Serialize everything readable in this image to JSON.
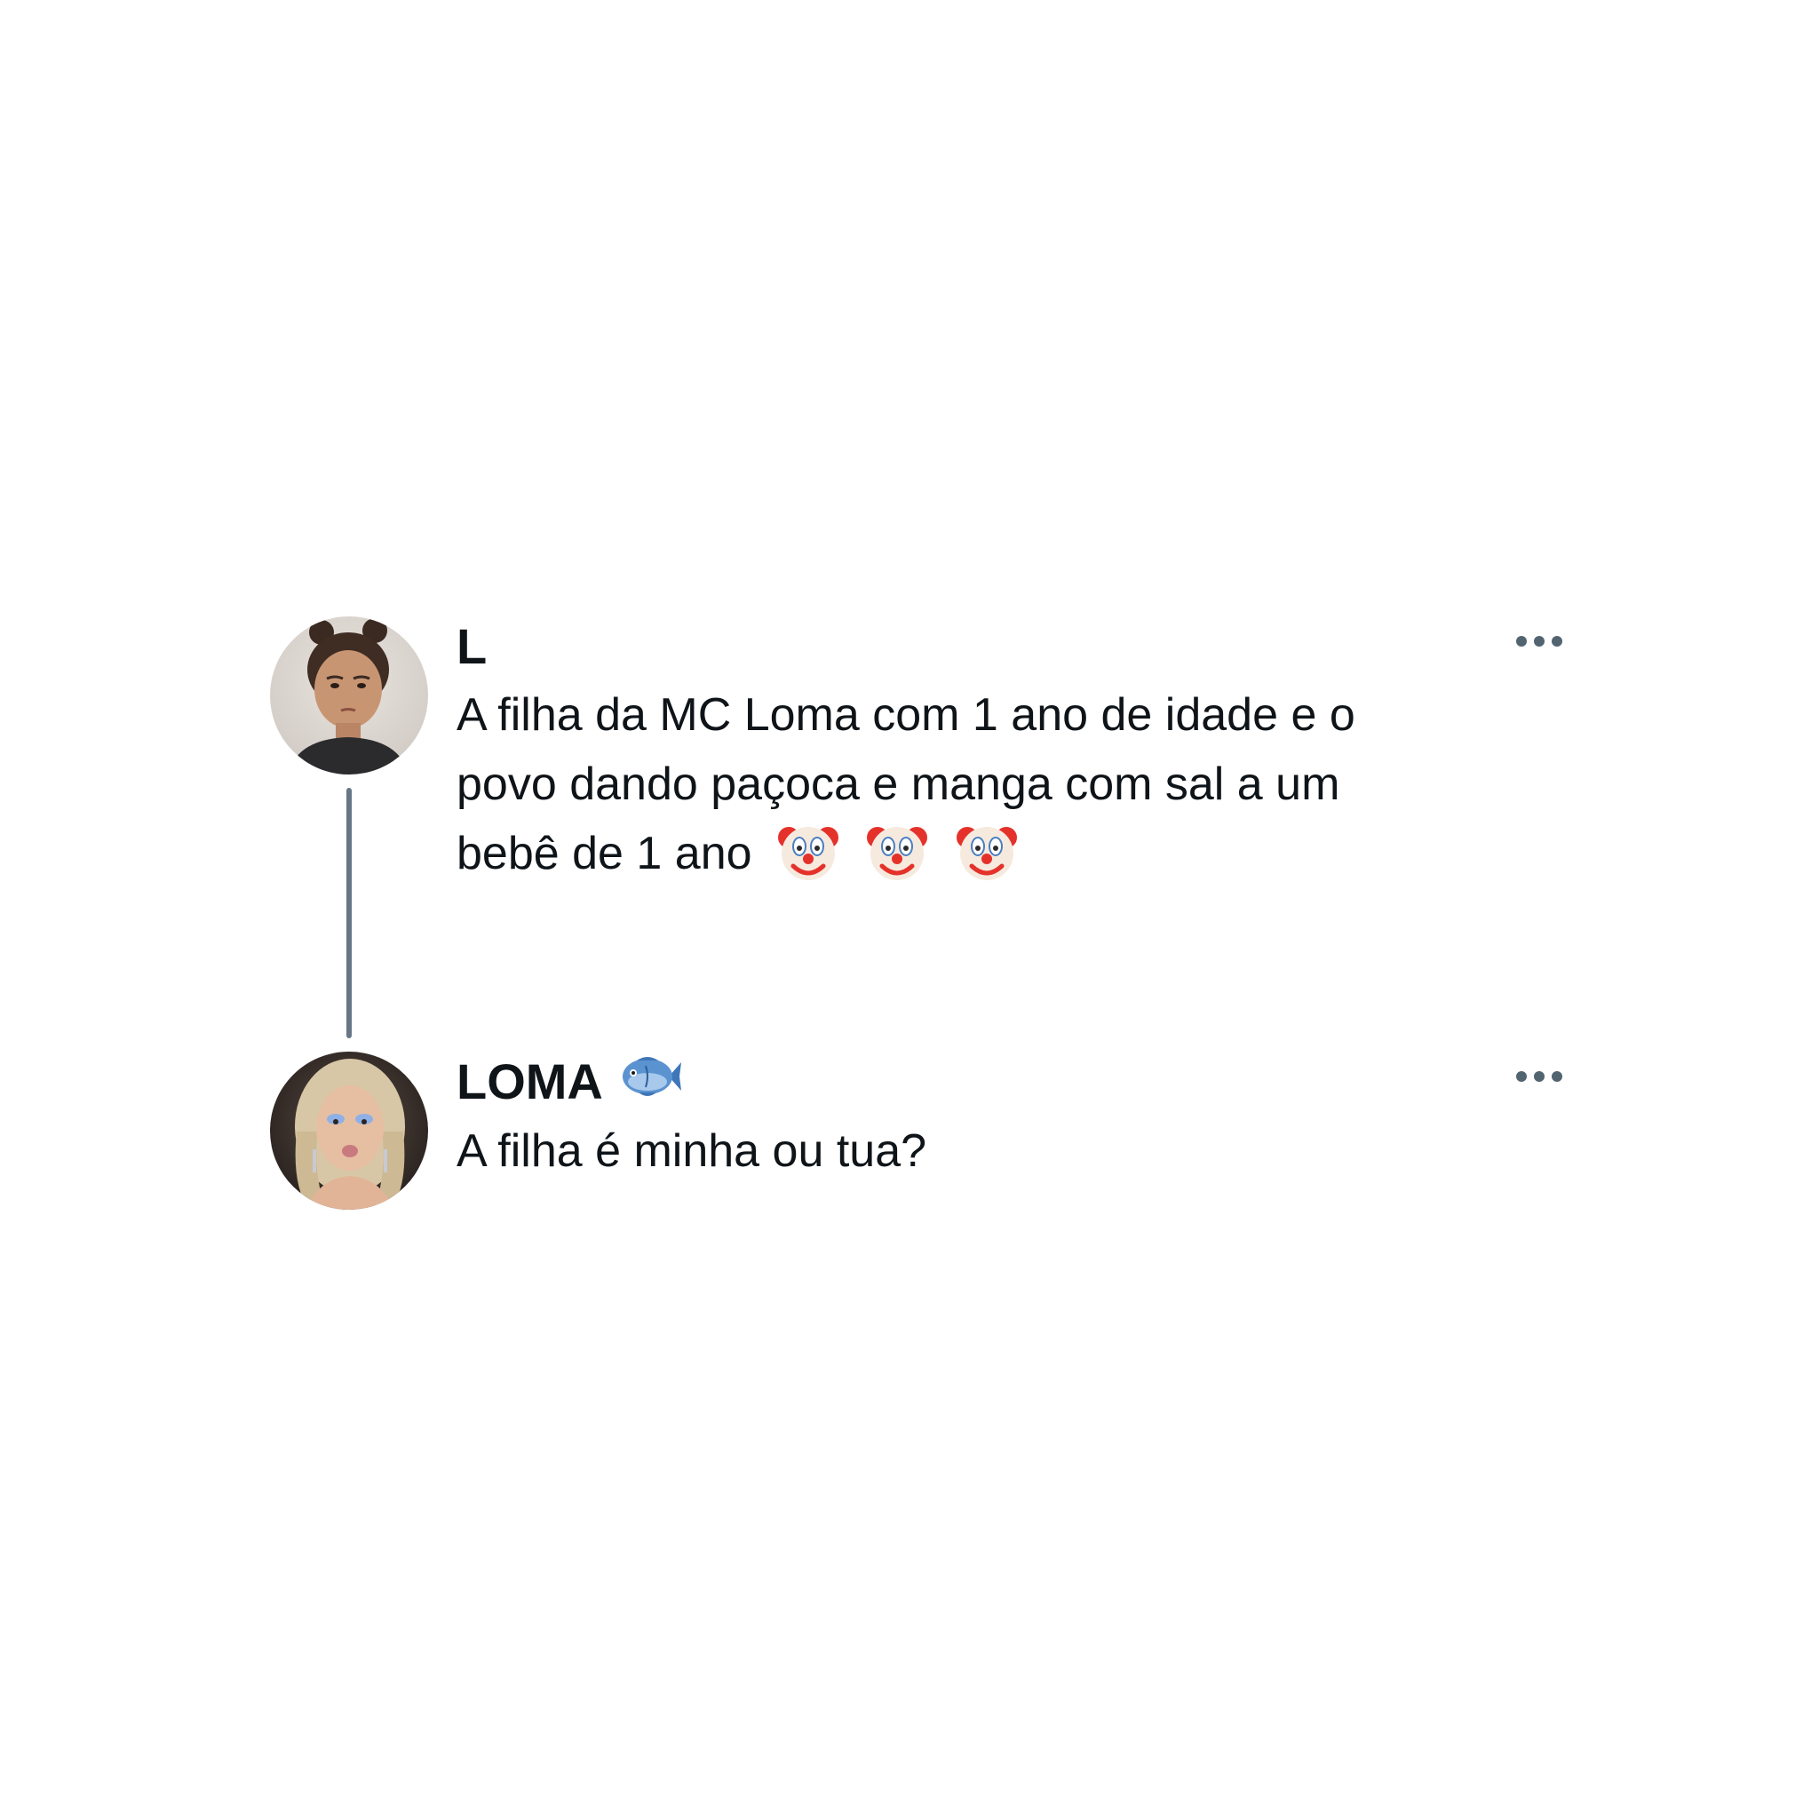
{
  "tweets": [
    {
      "author": "L",
      "author_emoji": "",
      "avatar": "child-avatar",
      "lines": [
        "A filha da MC Loma com 1 ano de idade e o",
        "povo dando paçoca e manga com sal a um",
        "bebê de 1 ano"
      ],
      "trailing_emoji": [
        "clown-face-icon",
        "clown-face-icon",
        "clown-face-icon"
      ],
      "more_icon": "more-options-icon"
    },
    {
      "author": "LOMA",
      "author_emoji": "fish-icon",
      "avatar": "loma-avatar",
      "lines": [
        "A filha é minha ou tua?"
      ],
      "more_icon": "more-options-icon"
    }
  ],
  "colors": {
    "text": "#0f1419",
    "thread_line": "#687785",
    "more_icon": "#536471",
    "background": "#ffffff"
  }
}
